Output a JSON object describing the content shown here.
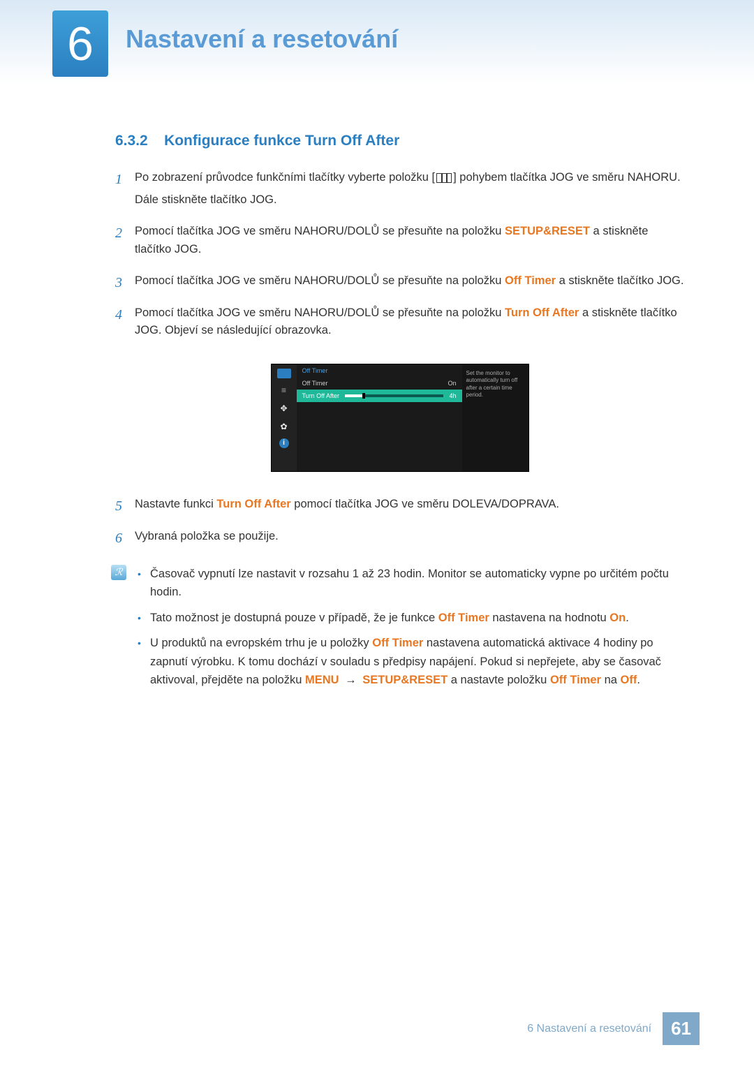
{
  "header": {
    "chapter_number": "6",
    "chapter_title": "Nastavení a resetování"
  },
  "section": {
    "number": "6.3.2",
    "title": "Konfigurace funkce Turn Off After"
  },
  "steps": [
    {
      "n": "1",
      "text_a": "Po zobrazení průvodce funkčními tlačítky vyberte položku [",
      "text_b": "] pohybem tlačítka JOG ve směru NAHORU.",
      "text_c": "Dále stiskněte tlačítko JOG."
    },
    {
      "n": "2",
      "text_a": "Pomocí tlačítka JOG ve směru NAHORU/DOLŮ se přesuňte na položku ",
      "hl": "SETUP&RESET",
      "text_b": " a stiskněte tlačítko JOG."
    },
    {
      "n": "3",
      "text_a": "Pomocí tlačítka JOG ve směru NAHORU/DOLŮ se přesuňte na položku ",
      "hl": "Off Timer",
      "text_b": " a stiskněte tlačítko JOG."
    },
    {
      "n": "4",
      "text_a": "Pomocí tlačítka JOG ve směru NAHORU/DOLŮ se přesuňte na položku ",
      "hl": "Turn Off After",
      "text_b": " a stiskněte tlačítko JOG. Objeví se následující obrazovka."
    },
    {
      "n": "5",
      "text_a": "Nastavte funkci ",
      "hl": "Turn Off After",
      "text_b": " pomocí tlačítka JOG ve směru DOLEVA/DOPRAVA."
    },
    {
      "n": "6",
      "text_a": "Vybraná položka se použije."
    }
  ],
  "osd": {
    "title": "Off Timer",
    "row1_label": "Off Timer",
    "row1_value": "On",
    "row2_label": "Turn Off After",
    "row2_value": "4h",
    "help": "Set the monitor to automatically turn off after a certain time period."
  },
  "notes": [
    {
      "text": "Časovač vypnutí lze nastavit v rozsahu 1 až 23 hodin. Monitor se automaticky vypne po určitém počtu hodin."
    },
    {
      "pre": "Tato možnost je dostupná pouze v případě, že je funkce ",
      "hl1": "Off Timer",
      "mid": " nastavena na hodnotu ",
      "hl2": "On",
      "post": "."
    },
    {
      "pre": "U produktů na evropském trhu je u položky ",
      "hl1": "Off Timer",
      "mid1": " nastavena automatická aktivace 4 hodiny po zapnutí výrobku. K tomu dochází v souladu s předpisy napájení. Pokud si nepřejete, aby se časovač aktivoval, přejděte na položku ",
      "hl2": "MENU",
      "arrow": " → ",
      "hl3": "SETUP&RESET",
      "mid2": " a nastavte položku ",
      "hl4": "Off Timer",
      "mid3": " na ",
      "hl5": "Off",
      "post": "."
    }
  ],
  "footer": {
    "text": "6 Nastavení a resetování",
    "page": "61"
  }
}
